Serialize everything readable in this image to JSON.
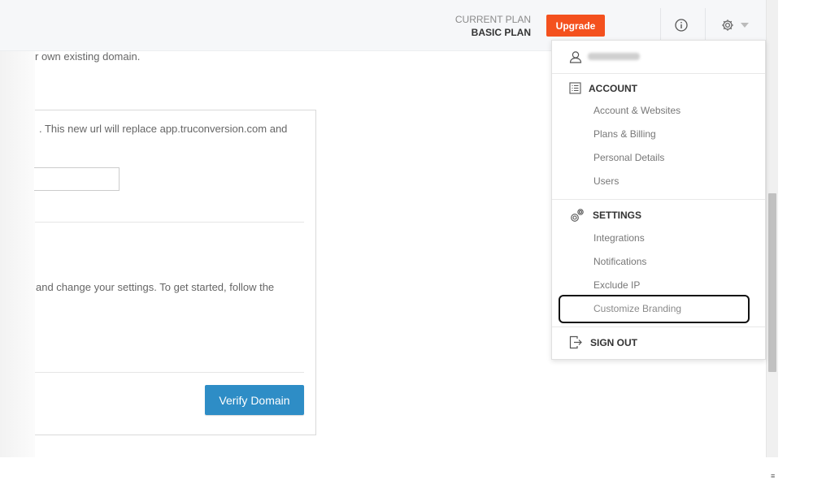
{
  "header": {
    "plan_label": "CURRENT PLAN",
    "plan_value": "BASIC PLAN",
    "upgrade_label": "Upgrade",
    "info_icon": "info-circle-icon",
    "settings_icon": "gear-icon",
    "caret_icon": "caret-down-icon"
  },
  "main": {
    "intro_text": "r own existing domain.",
    "panel_text_1": ". This new url will replace app.truconversion.com and",
    "panel_text_2": "and change your settings. To get started, follow the",
    "verify_label": "Verify Domain"
  },
  "dropdown": {
    "account_header": "ACCOUNT",
    "account_items": [
      "Account & Websites",
      "Plans & Billing",
      "Personal Details",
      "Users"
    ],
    "settings_header": "SETTINGS",
    "settings_items": [
      "Integrations",
      "Notifications",
      "Exclude IP",
      "Customize Branding"
    ],
    "signout_label": "SIGN OUT"
  },
  "colors": {
    "upgrade": "#f4511e",
    "verify": "#2e8dc6"
  }
}
